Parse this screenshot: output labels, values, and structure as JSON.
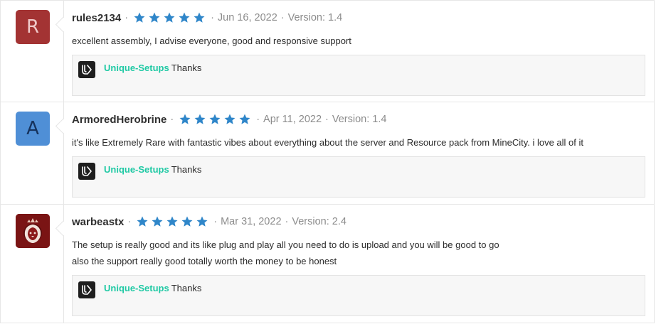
{
  "icons": {
    "star": "star-icon",
    "reply_logo": "unique-setups-logo-icon",
    "lion": "lion-crest-icon"
  },
  "colors": {
    "star": "#2f86c9",
    "reply_author": "#1fc9a4",
    "avatar_red": "#a33333",
    "avatar_blue": "#4f8fd6"
  },
  "reviews": [
    {
      "avatar_letter": "R",
      "username": "rules2134",
      "rating": 5,
      "date": "Jun 16, 2022",
      "version": "Version: 1.4",
      "lines": [
        "excellent assembly, I advise everyone, good and responsive support"
      ],
      "reply": {
        "author": "Unique-Setups",
        "text": "Thanks"
      }
    },
    {
      "avatar_letter": "A",
      "username": "ArmoredHerobrine",
      "rating": 5,
      "date": "Apr 11, 2022",
      "version": "Version: 1.4",
      "lines": [
        "it's like Extremely Rare with fantastic vibes about everything about the server and Resource pack from MineCity. i love all of it"
      ],
      "reply": {
        "author": "Unique-Setups",
        "text": "Thanks"
      }
    },
    {
      "avatar_letter": "",
      "username": "warbeastx",
      "rating": 5,
      "date": "Mar 31, 2022",
      "version": "Version: 2.4",
      "lines": [
        "The setup is really good and its like plug and play all you need to do is upload and you will be good to go",
        "also the support really good totally worth the money to be honest"
      ],
      "reply": {
        "author": "Unique-Setups",
        "text": "Thanks"
      }
    }
  ]
}
